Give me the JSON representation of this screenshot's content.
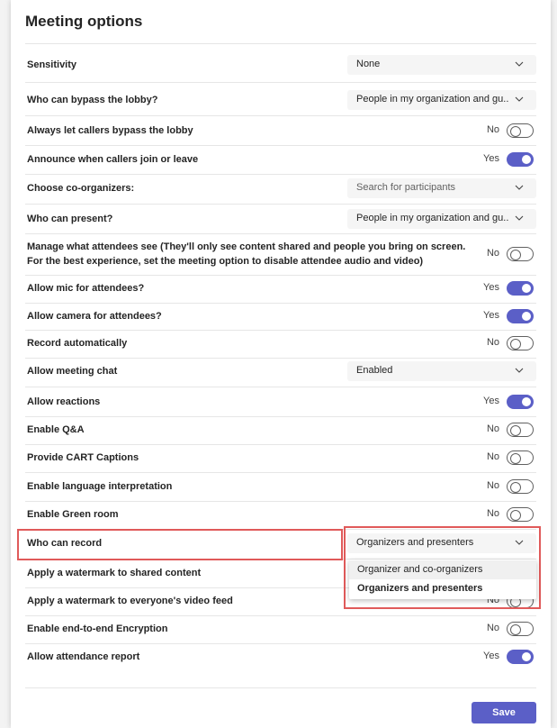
{
  "title": "Meeting options",
  "settings": [
    {
      "label": "Sensitivity",
      "type": "select",
      "value": "None"
    },
    {
      "label": "Who can bypass the lobby?",
      "type": "select",
      "value": "People in my organization and gu..."
    },
    {
      "label": "Always let callers bypass the lobby",
      "type": "toggle",
      "state": "No",
      "on": false
    },
    {
      "label": "Announce when callers join or leave",
      "type": "toggle",
      "state": "Yes",
      "on": true
    },
    {
      "label": "Choose co-organizers:",
      "type": "select",
      "value": "Search for participants",
      "placeholder": true
    },
    {
      "label": "Who can present?",
      "type": "select",
      "value": "People in my organization and gu..."
    },
    {
      "label": "Manage what attendees see (They'll only see content shared and people you bring on screen. For the best experience, set the meeting option to disable attendee audio and video)",
      "type": "toggle",
      "state": "No",
      "on": false
    },
    {
      "label": "Allow mic for attendees?",
      "type": "toggle",
      "state": "Yes",
      "on": true
    },
    {
      "label": "Allow camera for attendees?",
      "type": "toggle",
      "state": "Yes",
      "on": true
    },
    {
      "label": "Record automatically",
      "type": "toggle",
      "state": "No",
      "on": false
    },
    {
      "label": "Allow meeting chat",
      "type": "select",
      "value": "Enabled"
    },
    {
      "label": "Allow reactions",
      "type": "toggle",
      "state": "Yes",
      "on": true
    },
    {
      "label": "Enable Q&A",
      "type": "toggle",
      "state": "No",
      "on": false
    },
    {
      "label": "Provide CART Captions",
      "type": "toggle",
      "state": "No",
      "on": false
    },
    {
      "label": "Enable language interpretation",
      "type": "toggle",
      "state": "No",
      "on": false
    },
    {
      "label": "Enable Green room",
      "type": "toggle",
      "state": "No",
      "on": false
    },
    {
      "label": "Who can record",
      "type": "select",
      "value": "Organizers and presenters"
    },
    {
      "label": "Apply a watermark to shared content",
      "type": "toggle",
      "state": "",
      "on": false
    },
    {
      "label": "Apply a watermark to everyone's video feed",
      "type": "toggle",
      "state": "No",
      "on": false
    },
    {
      "label": "Enable end-to-end Encryption",
      "type": "toggle",
      "state": "No",
      "on": false
    },
    {
      "label": "Allow attendance report",
      "type": "toggle",
      "state": "Yes",
      "on": true
    }
  ],
  "record_dropdown": {
    "options": [
      "Organizer and co-organizers",
      "Organizers and presenters"
    ],
    "selected": "Organizers and presenters"
  },
  "save_label": "Save",
  "colors": {
    "accent": "#5b5fc7",
    "highlight": "#e05a5a"
  }
}
